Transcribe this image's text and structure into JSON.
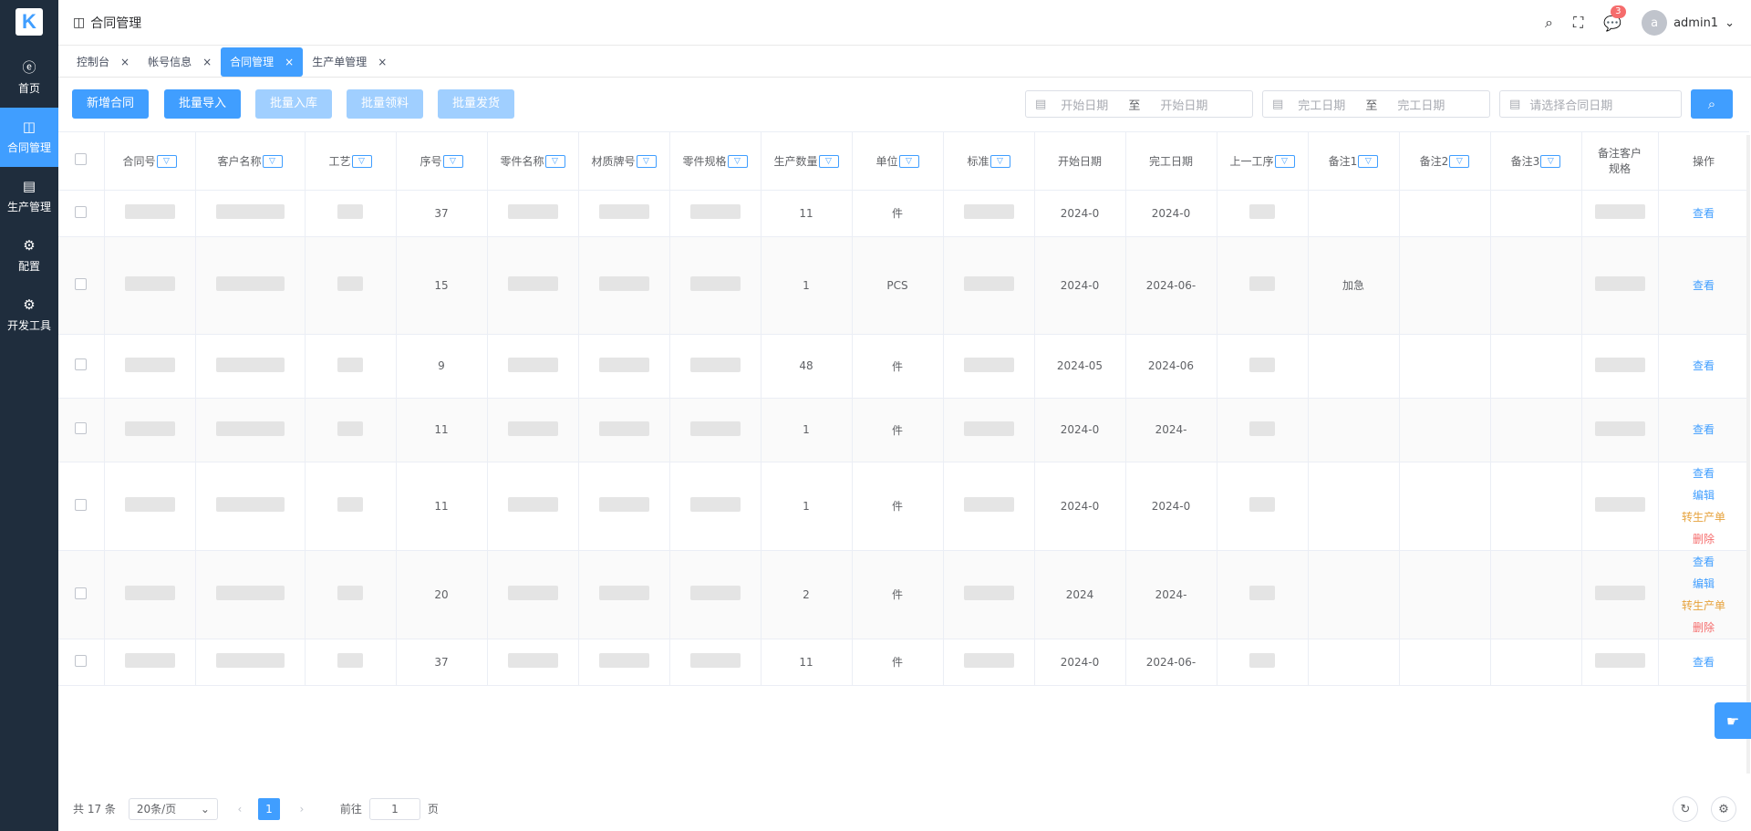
{
  "sidebar": {
    "logo": "K",
    "items": [
      {
        "label": "首页",
        "icon": "home-icon",
        "glyph": "ⓔ"
      },
      {
        "label": "合同管理",
        "icon": "contract-icon",
        "glyph": "◫",
        "active": true
      },
      {
        "label": "生产管理",
        "icon": "factory-icon",
        "glyph": "▤"
      },
      {
        "label": "配置",
        "icon": "gear-icon",
        "glyph": "⚙"
      },
      {
        "label": "开发工具",
        "icon": "tool-gear-icon",
        "glyph": "⚙"
      }
    ]
  },
  "header": {
    "title": "合同管理",
    "notification_count": "3",
    "avatar_letter": "a",
    "username": "admin1"
  },
  "tabs": [
    {
      "label": "控制台",
      "active": false
    },
    {
      "label": "帐号信息",
      "active": false
    },
    {
      "label": "合同管理",
      "active": true
    },
    {
      "label": "生产单管理",
      "active": false
    }
  ],
  "toolbar": {
    "add": "新增合同",
    "import": "批量导入",
    "stock_in": "批量入库",
    "pick": "批量领料",
    "ship": "批量发货",
    "start_from": "开始日期",
    "start_to": "开始日期",
    "range_sep": "至",
    "end_from": "完工日期",
    "end_to": "完工日期",
    "contract_date": "请选择合同日期"
  },
  "table": {
    "headers": [
      "合同号",
      "客户名称",
      "工艺",
      "序号",
      "零件名称",
      "材质牌号",
      "零件规格",
      "生产数量",
      "单位",
      "标准",
      "开始日期",
      "完工日期",
      "上一工序",
      "备注1",
      "备注2",
      "备注3",
      "备注客户规格",
      "操作"
    ],
    "header_notes": {
      "line1": "备注客户",
      "line2": "规格"
    },
    "rows": [
      {
        "seq": "37",
        "qty": "11",
        "unit": "件",
        "start": "2024-0",
        "end": "2024-0",
        "note1": "",
        "actions": [
          "查看"
        ]
      },
      {
        "seq": "15",
        "qty": "1",
        "unit": "PCS",
        "start": "2024-0",
        "end": "2024-06-",
        "note1": "加急",
        "actions": [
          "查看"
        ]
      },
      {
        "seq": "9",
        "qty": "48",
        "unit": "件",
        "start": "2024-05",
        "end": "2024-06",
        "note1": "",
        "actions": [
          "查看"
        ]
      },
      {
        "seq": "11",
        "qty": "1",
        "unit": "件",
        "start": "2024-0",
        "end": "2024-",
        "note1": "",
        "actions": [
          "查看"
        ]
      },
      {
        "seq": "11",
        "qty": "1",
        "unit": "件",
        "start": "2024-0",
        "end": "2024-0",
        "note1": "",
        "actions": [
          "查看",
          "编辑",
          "转生产单",
          "删除"
        ]
      },
      {
        "seq": "20",
        "qty": "2",
        "unit": "件",
        "start": "2024",
        "end": "2024-",
        "note1": "",
        "actions": [
          "查看",
          "编辑",
          "转生产单",
          "删除"
        ]
      },
      {
        "seq": "37",
        "qty": "11",
        "unit": "件",
        "start": "2024-0",
        "end": "2024-06-",
        "note1": "",
        "actions": [
          "查看"
        ]
      }
    ]
  },
  "footer": {
    "total": "共 17 条",
    "page_size": "20条/页",
    "current_page": "1",
    "goto_label": "前往",
    "goto_value": "1",
    "page_suffix": "页"
  }
}
